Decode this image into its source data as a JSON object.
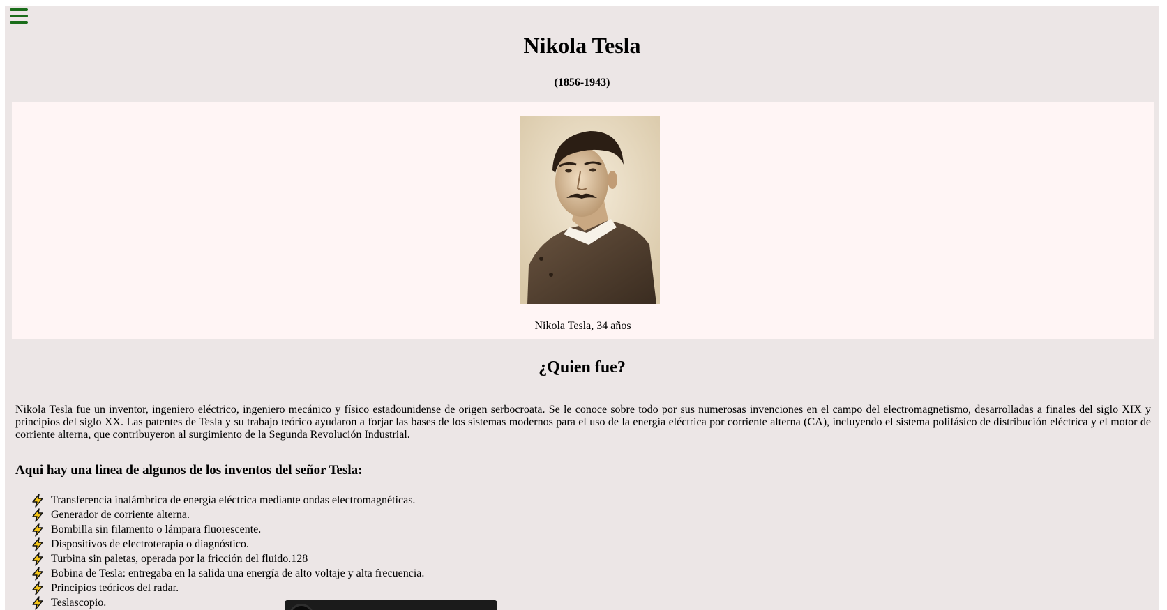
{
  "header": {
    "menu_icon": "hamburger-menu-icon",
    "title": "Nikola Tesla",
    "dates": "(1856-1943)"
  },
  "figure": {
    "image": "portrait-photo-sepia",
    "caption": "Nikola Tesla, 34 años"
  },
  "about": {
    "heading": "¿Quien fue?",
    "text": "Nikola Tesla fue un inventor, ingeniero eléctrico, ingeniero mecánico y físico estadounidense de origen serbocroata. Se le conoce sobre todo por sus numerosas invenciones en el campo del electromagnetismo, desarrolladas a finales del siglo XIX y principios del siglo XX. Las patentes de Tesla y su trabajo teórico ayudaron a forjar las bases de los sistemas modernos para el uso de la energía eléctrica por corriente alterna (CA), incluyendo el sistema polifásico de distribución eléctrica y el motor de corriente alterna, que contribuyeron al surgimiento de la Segunda Revolución Industrial."
  },
  "inventions": {
    "heading": "Aqui hay una linea de algunos de los inventos del señor Tesla:",
    "bullet_icon": "lightning-bolt-icon",
    "accent_color": "#f5c518",
    "items": [
      "Transferencia inalámbrica de energía eléctrica mediante ondas electromagnéticas.",
      "Generador de corriente alterna.",
      "Bombilla sin filamento o lámpara fluorescente.",
      "Dispositivos de electroterapia o diagnóstico.",
      "Turbina sin paletas, operada por la fricción del fluido.128",
      "Bobina de Tesla: entregaba en la salida una energía de alto voltaje y alta frecuencia.",
      "Principios teóricos del radar.",
      "Teslascopio."
    ]
  },
  "colors": {
    "page_background": "#ece6e6",
    "figure_background": "#fff5f5",
    "menu_icon": "#1a6d1a"
  }
}
